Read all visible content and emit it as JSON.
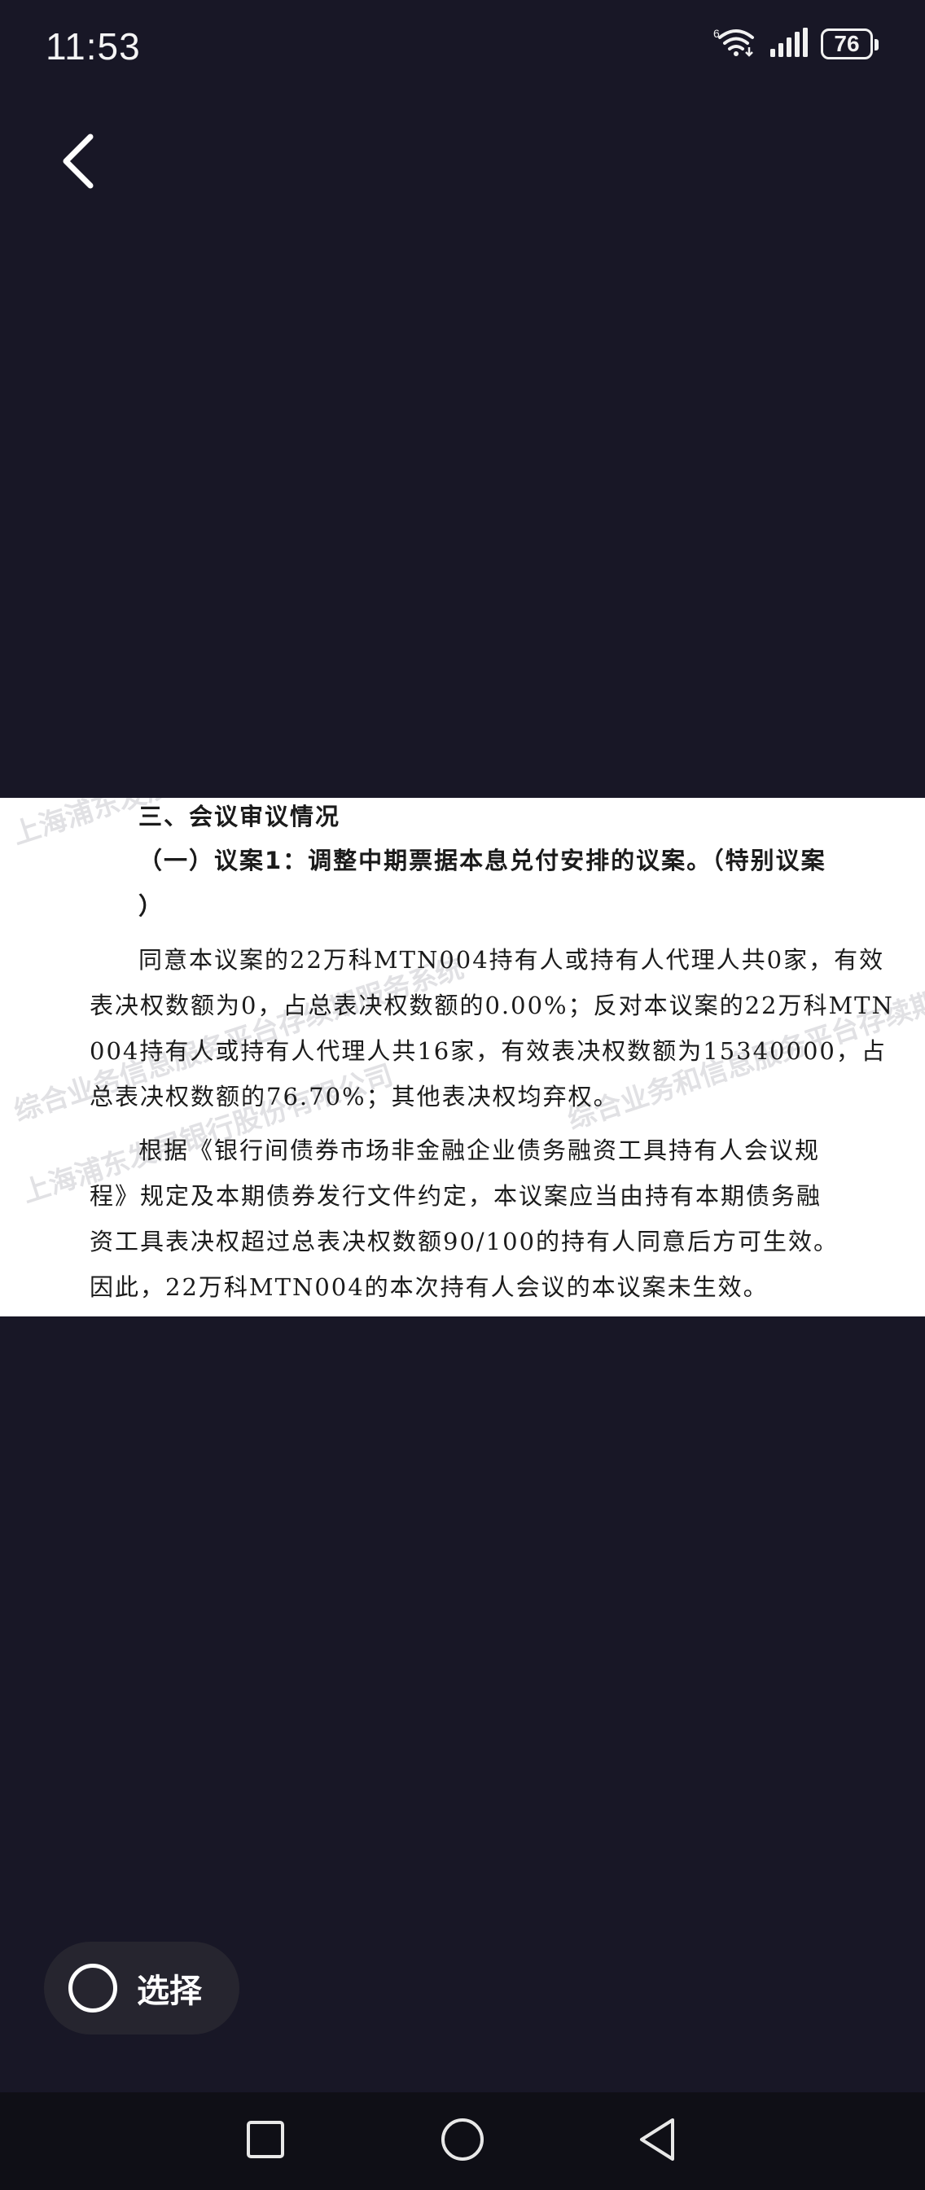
{
  "status_bar": {
    "time": "11:53",
    "battery": "76",
    "icons": [
      "wifi-6-icon",
      "signal-icon",
      "battery-icon"
    ]
  },
  "header": {
    "back_icon": "chevron-left-icon"
  },
  "document": {
    "heading": "三、会议审议情况",
    "proposal_title": "（一）议案1：调整中期票据本息兑付安排的议案。（特别议案",
    "proposal_title_end": "）",
    "para1": [
      "同意本议案的22万科MTN004持有人或持有人代理人共0家，有效",
      "表决权数额为0，占总表决权数额的0.00%；反对本议案的22万科MTN",
      "004持有人或持有人代理人共16家，有效表决权数额为15340000，占",
      "总表决权数额的76.70%；其他表决权均弃权。"
    ],
    "para2": [
      "根据《银行间债券市场非金融企业债务融资工具持有人会议规",
      "程》规定及本期债券发行文件约定，本议案应当由持有本期债务融",
      "资工具表决权超过总表决权数额90/100的持有人同意后方可生效。",
      "因此，22万科MTN004的本次持有人会议的本议案未生效。"
    ],
    "watermarks": [
      "上海浦东发展银行股份有限公司",
      "综合业务信息服务平台存续期服务系统",
      "上海浦东发展银行股份有限公司",
      "综合业务和信息服务平台存续期"
    ]
  },
  "select_button": {
    "label": "选择"
  },
  "nav_bar": {
    "icons": [
      "recent-apps-icon",
      "home-icon",
      "back-triangle-icon"
    ]
  }
}
